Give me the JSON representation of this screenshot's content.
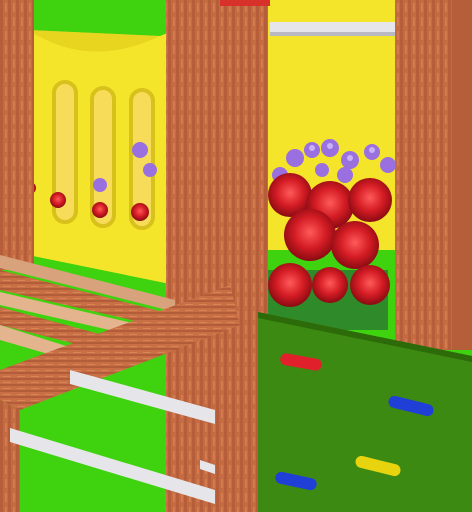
{
  "scene": {
    "description_name": "playground-3d-view",
    "colors": {
      "grass": "#3fd20e",
      "yellow_panel": "#f5e52a",
      "wood_post": "#c96f45",
      "wood_dark": "#a4543a",
      "climbing_wall": "#3d8a12",
      "rail": "#e6e6ea",
      "rose": "#d0202a",
      "violet": "#9a6fe0",
      "hold_red": "#e0202a",
      "hold_blue": "#1f3fd6",
      "hold_yellow": "#e8d40e"
    },
    "objects": [
      "yellow-back-panel",
      "arched-window",
      "wooden-post",
      "horizontal-rail",
      "wooden-beam",
      "climbing-wall",
      "climbing-hold",
      "rose-bush",
      "violet-flowers"
    ]
  }
}
